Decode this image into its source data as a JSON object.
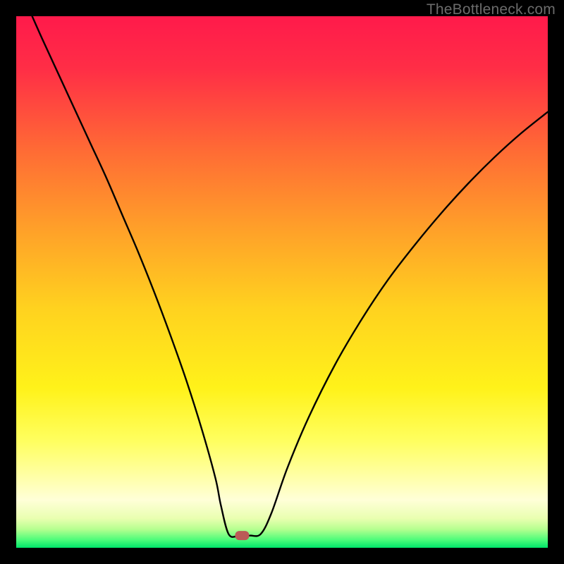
{
  "watermark": "TheBottleneck.com",
  "chart_data": {
    "type": "line",
    "title": "",
    "xlabel": "",
    "ylabel": "",
    "xlim": [
      0,
      100
    ],
    "ylim": [
      0,
      100
    ],
    "x": [
      3,
      5,
      8,
      11,
      14,
      17,
      20,
      23,
      26,
      29,
      32,
      35,
      37.5,
      38.5,
      40,
      42,
      44,
      46,
      48,
      51,
      55,
      60,
      65,
      70,
      75,
      80,
      85,
      90,
      95,
      100
    ],
    "values": [
      100,
      95.5,
      89,
      82.5,
      76,
      69.5,
      62.5,
      55.5,
      48,
      40,
      31.5,
      22,
      13,
      8,
      2.5,
      2.3,
      2.3,
      2.6,
      6.5,
      15,
      24.5,
      34.5,
      43,
      50.5,
      57,
      63,
      68.5,
      73.5,
      78,
      82
    ],
    "marker": {
      "x": 42.5,
      "y": 2.3,
      "color": "#bb5a57"
    },
    "gradient_stops": [
      {
        "offset": 0.0,
        "color": "#ff1a4b"
      },
      {
        "offset": 0.1,
        "color": "#ff2e46"
      },
      {
        "offset": 0.25,
        "color": "#ff6a35"
      },
      {
        "offset": 0.4,
        "color": "#ffa029"
      },
      {
        "offset": 0.55,
        "color": "#ffd21f"
      },
      {
        "offset": 0.7,
        "color": "#fff21a"
      },
      {
        "offset": 0.8,
        "color": "#ffff60"
      },
      {
        "offset": 0.86,
        "color": "#ffffa0"
      },
      {
        "offset": 0.91,
        "color": "#ffffd8"
      },
      {
        "offset": 0.945,
        "color": "#e9ffb0"
      },
      {
        "offset": 0.965,
        "color": "#b6ff90"
      },
      {
        "offset": 0.985,
        "color": "#4dfc7a"
      },
      {
        "offset": 1.0,
        "color": "#00e56a"
      }
    ]
  }
}
